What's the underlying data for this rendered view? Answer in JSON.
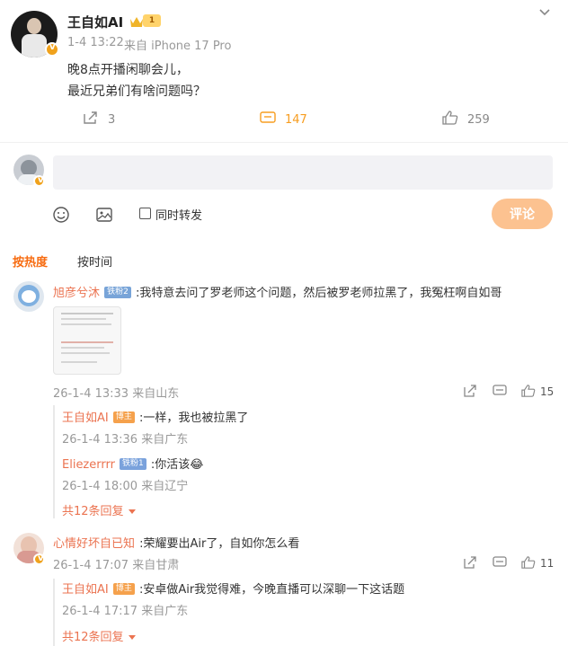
{
  "post": {
    "author": "王自如AI",
    "level_badge": "1",
    "time": "1-4 13:22",
    "source": "来自 iPhone 17 Pro",
    "text_lines": [
      "晚8点开播闲聊会儿，",
      "最近兄弟们有啥问题吗？"
    ],
    "reposts": "3",
    "comments": "147",
    "likes": "259"
  },
  "composer": {
    "input_placeholder": "",
    "also_repost_label": "同时转发",
    "submit_label": "评论"
  },
  "sort": {
    "hot": "按热度",
    "time": "按时间"
  },
  "comments": [
    {
      "name": "旭彦兮沐",
      "tag": "铁粉2",
      "text": ":我特意去问了罗老师这个问题，然后被罗老师拉黑了，我冤枉啊自如哥",
      "meta": "26-1-4 13:33 来自山东",
      "likes": "15",
      "replies": [
        {
          "name": "王自如AI",
          "tag": "博主",
          "text": ":一样，我也被拉黑了",
          "meta": "26-1-4 13:36 来自广东"
        },
        {
          "name": "Eliezerrrr",
          "tag": "铁粉1",
          "text": ":你活该😂",
          "meta": "26-1-4 18:00 来自辽宁"
        }
      ],
      "more": "共12条回复"
    },
    {
      "name": "心情好坏自已知",
      "text": ":荣耀要出Air了，自如你怎么看",
      "meta": "26-1-4 17:07 来自甘肃",
      "likes": "11",
      "replies": [
        {
          "name": "王自如AI",
          "tag": "博主",
          "text": ":安卓做Air我觉得难，今晚直播可以深聊一下这话题",
          "meta": "26-1-4 17:17 来自广东"
        }
      ],
      "more": "共12条回复"
    }
  ],
  "colors": {
    "accent_orange": "#f79d20",
    "name_link": "#eb7350",
    "submit_disabled": "#fcc290"
  }
}
